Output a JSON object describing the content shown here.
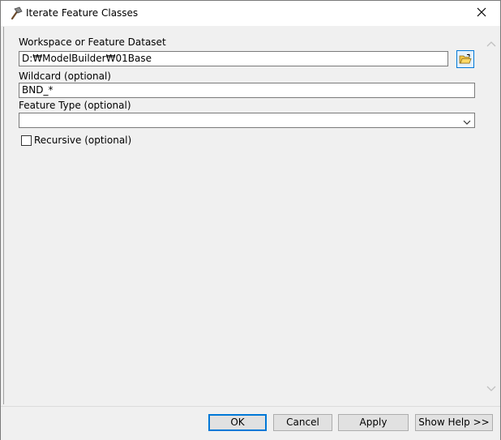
{
  "window": {
    "title": "Iterate Feature Classes",
    "icon": "hammer-icon",
    "close_icon": "close-icon"
  },
  "form": {
    "workspace": {
      "label": "Workspace or Feature Dataset",
      "value": "D:₩ModelBuilder₩01Base",
      "browse_icon": "folder-open-icon"
    },
    "wildcard": {
      "label": "Wildcard (optional)",
      "value": "BND_*"
    },
    "feature_type": {
      "label": "Feature Type (optional)",
      "value": ""
    },
    "recursive": {
      "label": "Recursive (optional)",
      "checked": false
    }
  },
  "buttons": {
    "ok": "OK",
    "cancel": "Cancel",
    "apply": "Apply",
    "show_help": "Show Help >>"
  },
  "colors": {
    "accent": "#0078d7",
    "panel_bg": "#f0f0f0"
  }
}
